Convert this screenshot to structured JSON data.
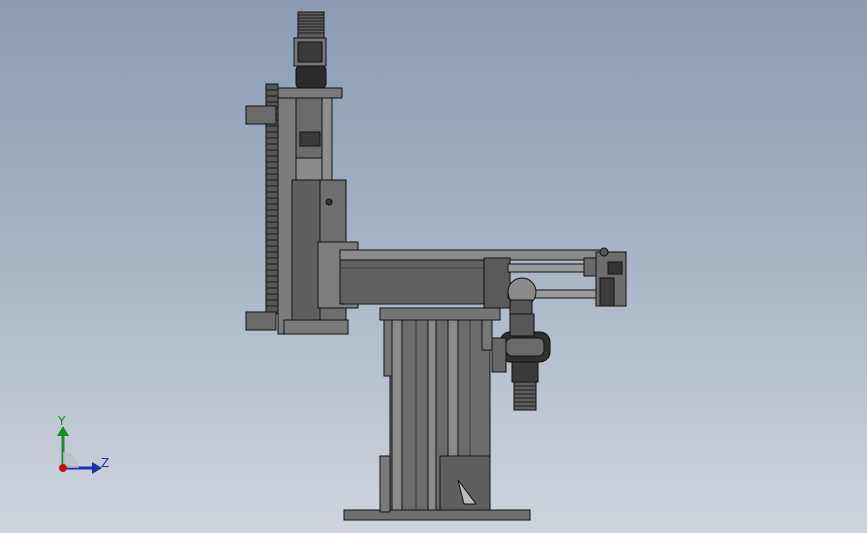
{
  "viewport": {
    "background_top": "#8b9cb3",
    "background_bottom": "#cfd5dd"
  },
  "model": {
    "description_icon": "cad-assembly",
    "body_color": "#6f6f6f",
    "edge_color": "#111111",
    "highlight_color": "#9a9a9a"
  },
  "triad": {
    "y_label": "Y",
    "z_label": "Z",
    "y_color": "#1a8a2a",
    "z_color": "#1a2fb0",
    "origin_color": "#c01010"
  }
}
